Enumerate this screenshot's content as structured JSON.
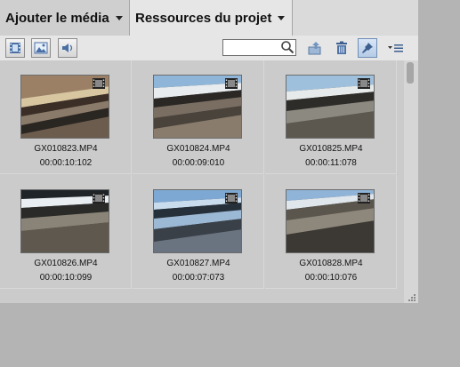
{
  "tabs": {
    "media_label": "Ajouter le média",
    "resources_label": "Ressources du projet"
  },
  "toolbar": {
    "view_modes": [
      "film-view-icon",
      "image-view-icon",
      "audio-view-icon"
    ],
    "search_placeholder": "",
    "actions": [
      "import-icon",
      "trash-icon",
      "pin-icon",
      "menu-icon"
    ]
  },
  "clips": [
    {
      "name": "GX010823.MP4",
      "duration": "00:00:10:102"
    },
    {
      "name": "GX010824.MP4",
      "duration": "00:00:09:010"
    },
    {
      "name": "GX010825.MP4",
      "duration": "00:00:11:078"
    },
    {
      "name": "GX010826.MP4",
      "duration": "00:00:10:099"
    },
    {
      "name": "GX010827.MP4",
      "duration": "00:00:07:073"
    },
    {
      "name": "GX010828.MP4",
      "duration": "00:00:10:076"
    }
  ],
  "colors": {
    "panel": "#c8c8c8",
    "active_tab": "#e6e6e6",
    "background": "#b4b4b4",
    "pin_active": "#b5cbe6"
  }
}
